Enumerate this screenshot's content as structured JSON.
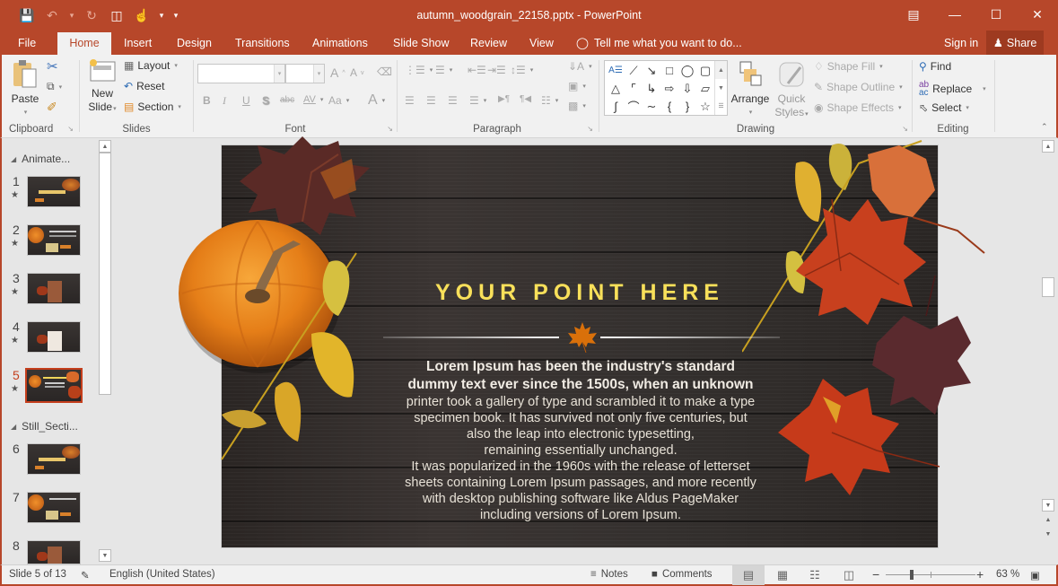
{
  "window": {
    "title": "autumn_woodgrain_22158.pptx - PowerPoint",
    "controls": [
      "ribbon-display-options",
      "minimize",
      "maximize",
      "close"
    ]
  },
  "quick_access": {
    "items": [
      "save",
      "undo",
      "redo",
      "start-from-beginning",
      "touch-mouse-mode",
      "customize"
    ]
  },
  "tabs": [
    {
      "label": "File"
    },
    {
      "label": "Home",
      "active": true
    },
    {
      "label": "Insert"
    },
    {
      "label": "Design"
    },
    {
      "label": "Transitions"
    },
    {
      "label": "Animations"
    },
    {
      "label": "Slide Show"
    },
    {
      "label": "Review"
    },
    {
      "label": "View"
    }
  ],
  "tell_me": {
    "placeholder": "Tell me what you want to do..."
  },
  "account": {
    "sign_in": "Sign in",
    "share": "Share"
  },
  "ribbon": {
    "clipboard": {
      "label": "Clipboard",
      "paste": "Paste"
    },
    "slides": {
      "label": "Slides",
      "new_slide_1": "New",
      "new_slide_2": "Slide",
      "layout": "Layout",
      "reset": "Reset",
      "section": "Section"
    },
    "font": {
      "label": "Font",
      "font_name": "",
      "font_size": "",
      "bold": "B",
      "italic": "I",
      "underline": "U",
      "shadow": "S",
      "strikethrough": "abc",
      "spacing": "AV",
      "case": "Aa",
      "color": "A",
      "grow": "A",
      "shrink": "A"
    },
    "paragraph": {
      "label": "Paragraph"
    },
    "drawing": {
      "label": "Drawing",
      "arrange": "Arrange",
      "quick_styles_1": "Quick",
      "quick_styles_2": "Styles",
      "shape_fill": "Shape Fill",
      "shape_outline": "Shape Outline",
      "shape_effects": "Shape Effects"
    },
    "editing": {
      "label": "Editing",
      "find": "Find",
      "replace": "Replace",
      "select": "Select"
    }
  },
  "slide_panel": {
    "sections": [
      {
        "name": "Animate...",
        "slides": [
          1,
          2,
          3,
          4,
          5
        ]
      },
      {
        "name": "Still_Secti...",
        "slides": [
          6,
          7,
          8
        ]
      }
    ],
    "slides": [
      {
        "number": "1",
        "animated": true
      },
      {
        "number": "2",
        "animated": true
      },
      {
        "number": "3",
        "animated": true
      },
      {
        "number": "4",
        "animated": true
      },
      {
        "number": "5",
        "animated": true,
        "selected": true
      },
      {
        "number": "6",
        "animated": false
      },
      {
        "number": "7",
        "animated": false
      },
      {
        "number": "8",
        "animated": false
      }
    ]
  },
  "slide": {
    "title": "YOUR POINT HERE",
    "bold_lines": [
      "Lorem Ipsum has been the industry's standard",
      "dummy text ever since the 1500s, when an unknown"
    ],
    "lines": [
      "printer took a gallery of type and scrambled it to make a type",
      "specimen book. It has survived not only five centuries, but",
      "also the leap into electronic typesetting,",
      "remaining essentially unchanged.",
      "It was popularized in the 1960s with the release of letterset",
      "sheets containing Lorem Ipsum passages, and more recently",
      "with desktop publishing software like Aldus PageMaker",
      "including versions of Lorem Ipsum."
    ],
    "colors": {
      "title": "#f8e05a",
      "accent_leaf": "#d9700a"
    }
  },
  "status": {
    "slide_info": "Slide 5 of 13",
    "language": "English (United States)",
    "notes": "Notes",
    "comments": "Comments",
    "zoom": "63 %",
    "zoom_level_percent": 63
  },
  "theme": {
    "accent": "#b7472a",
    "selected_slide_border": "#c43e1c"
  }
}
